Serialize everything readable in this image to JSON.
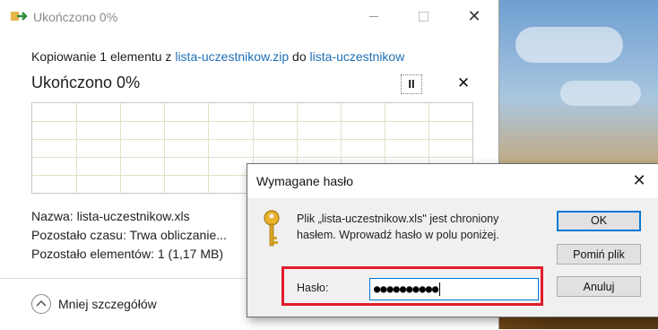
{
  "window": {
    "title": "Ukończono 0%",
    "copy_prefix": "Kopiowanie 1 elementu z ",
    "source": "lista-uczestnikow.zip",
    "copy_mid": " do ",
    "destination": "lista-uczestnikow",
    "progress_title": "Ukończono 0%",
    "progress_fraction": 0,
    "pause_glyph": "II",
    "stop_glyph": "✕",
    "close_glyph": "✕",
    "name_label": "Nazwa: ",
    "name_value": "lista-uczestnikow.xls",
    "time_label": "Pozostało czasu: ",
    "time_value": "Trwa obliczanie...",
    "items_label": "Pozostało elementów: ",
    "items_value": "1 (1,17 MB)",
    "details_toggle": "Mniej szczegółów"
  },
  "dialog": {
    "title": "Wymagane hasło",
    "close_glyph": "✕",
    "message": "Plik „lista-uczestnikow.xls\" jest chroniony hasłem. Wprowadź hasło w polu poniżej.",
    "password_label": "Hasło:",
    "password_value": "●●●●●●●●●●",
    "ok_label": "OK",
    "skip_label": "Pomiń plik",
    "cancel_label": "Anuluj"
  },
  "colors": {
    "link": "#1e6fb8",
    "highlight_box": "#e11b2c",
    "focus": "#0078d7"
  }
}
